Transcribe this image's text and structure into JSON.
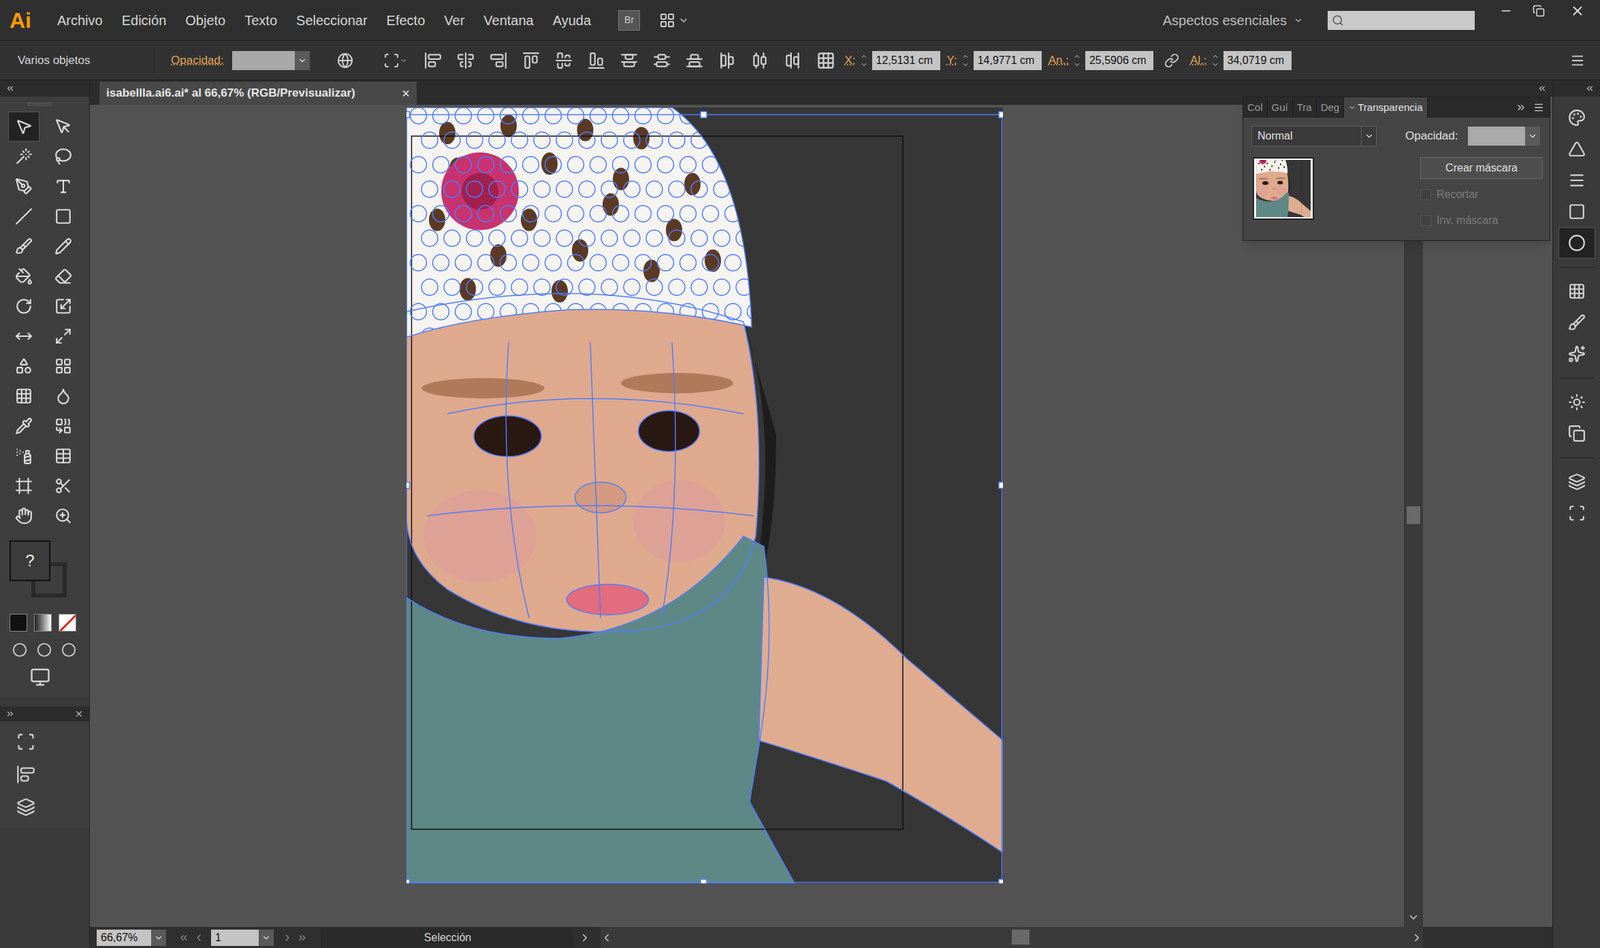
{
  "app": {
    "logo": "Ai",
    "menus": [
      "Archivo",
      "Edición",
      "Objeto",
      "Texto",
      "Seleccionar",
      "Efecto",
      "Ver",
      "Ventana",
      "Ayuda"
    ],
    "bridge": "Br",
    "workspace": "Aspectos esenciales"
  },
  "control_bar": {
    "selection": "Varios objetos",
    "opacity_label": "Opacidad:",
    "fields": [
      {
        "label": "X:",
        "value": "12,5131 cm"
      },
      {
        "label": "Y:",
        "value": "14,9771 cm"
      },
      {
        "label": "An.:",
        "value": "25,5906 cm"
      },
      {
        "label": "Al.:",
        "value": "34,0719 cm"
      }
    ]
  },
  "document": {
    "title": "isabellla.ai6.ai* al 66,67% (RGB/Previsualizar)",
    "close": "×",
    "selected": true
  },
  "toolbar": {
    "tools": [
      {
        "selected": true
      },
      {
        "selected": false
      },
      {
        "selected": false
      },
      {
        "selected": false
      },
      {
        "selected": false
      },
      {
        "selected": false
      },
      {
        "selected": false
      },
      {
        "selected": false
      },
      {
        "selected": false
      },
      {
        "selected": false
      },
      {
        "selected": false
      },
      {
        "selected": false
      },
      {
        "selected": false
      },
      {
        "selected": false
      },
      {
        "selected": false
      },
      {
        "selected": false
      },
      {
        "selected": false
      },
      {
        "selected": false
      },
      {
        "selected": false
      },
      {
        "selected": false
      },
      {
        "selected": false
      },
      {
        "selected": false
      },
      {
        "selected": false
      },
      {
        "selected": false
      },
      {
        "selected": false
      },
      {
        "selected": false
      },
      {
        "selected": false
      },
      {
        "selected": false
      }
    ],
    "fill_stroke": "?"
  },
  "dock_icons": [
    {
      "selected": false
    },
    {
      "selected": false
    },
    {
      "selected": false
    },
    {
      "selected": false
    },
    {
      "selected": true
    },
    {
      "selected": false
    },
    {
      "selected": false
    },
    {
      "selected": false
    },
    {
      "selected": false
    },
    {
      "selected": false
    },
    {
      "selected": false
    },
    {
      "selected": false
    }
  ],
  "transparency_panel": {
    "tabs": [
      {
        "label": "Col",
        "selected": false
      },
      {
        "label": "Guí",
        "selected": false
      },
      {
        "label": "Tra",
        "selected": false
      },
      {
        "label": "Deg",
        "selected": false
      },
      {
        "label": "Transparencia",
        "selected": true
      }
    ],
    "blend_mode": "Normal",
    "opacity_label": "Opacidad:",
    "mask_button": "Crear máscara",
    "options": [
      {
        "label": "Recortar",
        "checked": false,
        "disabled": true
      },
      {
        "label": "Inv. máscara",
        "checked": false,
        "disabled": true
      }
    ]
  },
  "canvas": {
    "vertical_scroll": {
      "level": 0.5
    },
    "horizontal_scroll": {
      "level": 0.5
    }
  },
  "status_bar": {
    "zoom": "66,67%",
    "page": "1",
    "tool": "Selección"
  }
}
